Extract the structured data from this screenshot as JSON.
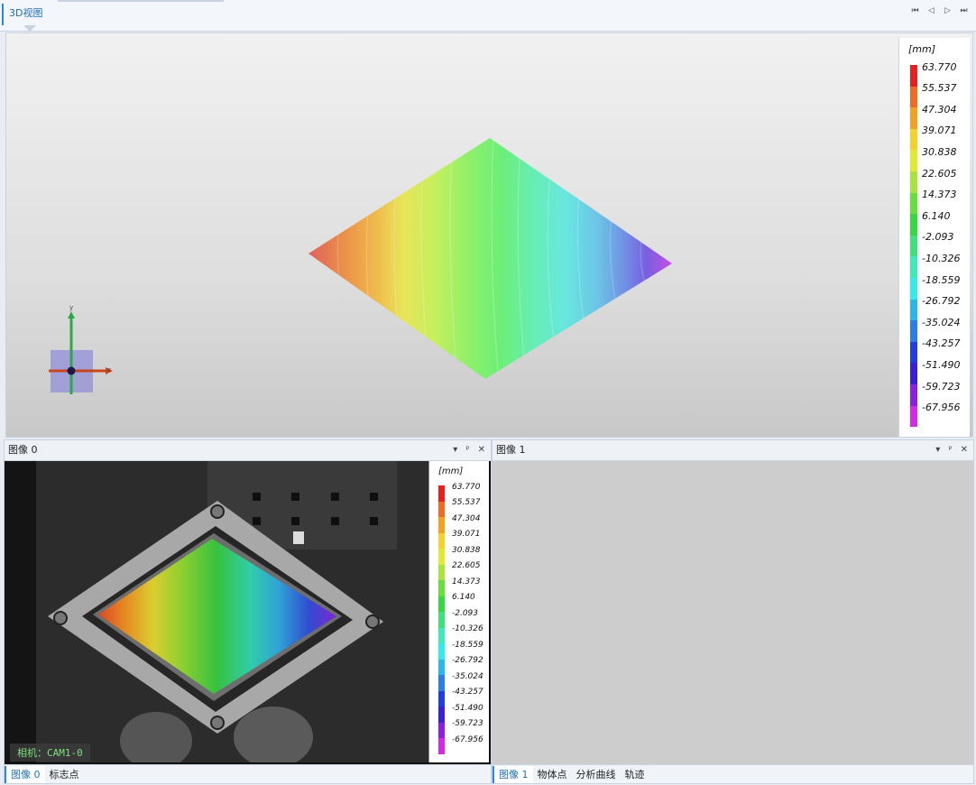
{
  "top": {
    "tab_label": "3D视图",
    "nav": [
      "first-page-icon",
      "prev-icon",
      "next-icon",
      "last-page-icon"
    ]
  },
  "legend": {
    "unit": "[mm]",
    "values": [
      "63.770",
      "55.537",
      "47.304",
      "39.071",
      "30.838",
      "22.605",
      "14.373",
      "6.140",
      "-2.093",
      "-10.326",
      "-18.559",
      "-26.792",
      "-35.024",
      "-43.257",
      "-51.490",
      "-59.723",
      "-67.956"
    ],
    "colors": [
      "#e8201c",
      "#f06a22",
      "#f4a11f",
      "#f4d22a",
      "#dfea30",
      "#a8e43a",
      "#63e03a",
      "#35d840",
      "#3ee27a",
      "#3cecb8",
      "#30ecec",
      "#2ab8ec",
      "#2a7ee8",
      "#1f3fe0",
      "#3a1fd8",
      "#8c1fe0",
      "#d22ae6"
    ]
  },
  "axes": {
    "x_label": "x",
    "y_label": "y"
  },
  "panes": {
    "image0": {
      "title": "图像 0",
      "camera_label": "相机：CAM1-0",
      "tabs": [
        "图像 0",
        "标志点"
      ]
    },
    "image1": {
      "title": "图像 1",
      "tabs": [
        "图像 1",
        "物体点",
        "分析曲线",
        "轨迹"
      ]
    }
  },
  "pane_controls": [
    "dropdown-icon",
    "pin-icon",
    "close-icon"
  ]
}
